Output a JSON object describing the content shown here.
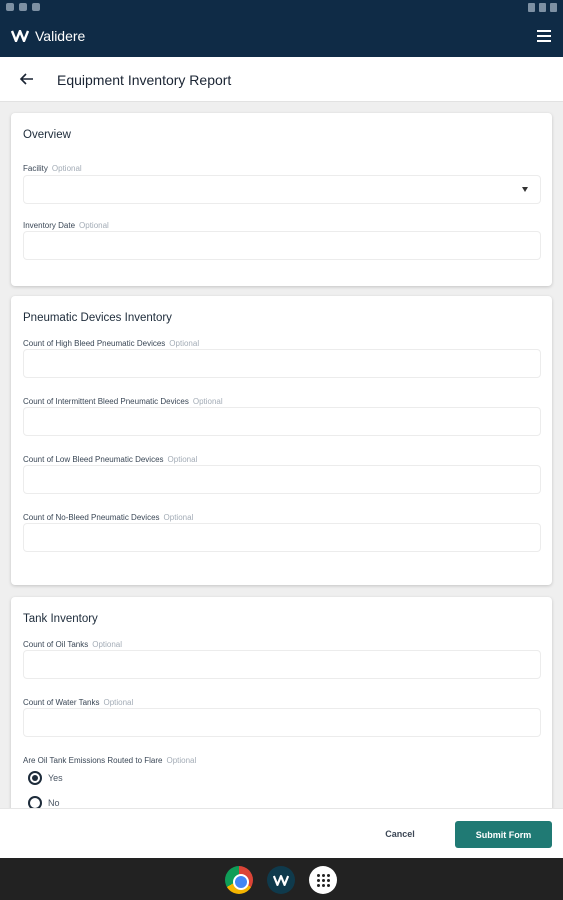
{
  "app": {
    "brand": "Validere"
  },
  "header": {
    "title": "Equipment Inventory Report"
  },
  "sections": {
    "overview": {
      "title": "Overview",
      "facility_label": "Facility",
      "facility_value": "",
      "inventory_date_label": "Inventory Date",
      "inventory_date_value": ""
    },
    "pneumatic": {
      "title": "Pneumatic Devices Inventory",
      "high_bleed_label": "Count of High Bleed Pneumatic Devices",
      "intermittent_bleed_label": "Count of Intermittent Bleed Pneumatic Devices",
      "low_bleed_label": "Count of Low Bleed Pneumatic Devices",
      "no_bleed_label": "Count of No-Bleed Pneumatic Devices"
    },
    "tank": {
      "title": "Tank Inventory",
      "oil_tanks_label": "Count of Oil Tanks",
      "water_tanks_label": "Count of Water Tanks",
      "flare_label": "Are Oil Tank Emissions Routed to Flare",
      "flare_options": [
        "Yes",
        "No"
      ],
      "flare_selected": "Yes"
    }
  },
  "optional_text": "Optional",
  "footer": {
    "cancel_label": "Cancel",
    "submit_label": "Submit Form"
  },
  "colors": {
    "appbar": "#0f2b46",
    "accent": "#207a74"
  },
  "icons": {
    "menu": "hamburger-icon",
    "back": "arrow-left-icon",
    "dropdown": "caret-down-icon"
  }
}
